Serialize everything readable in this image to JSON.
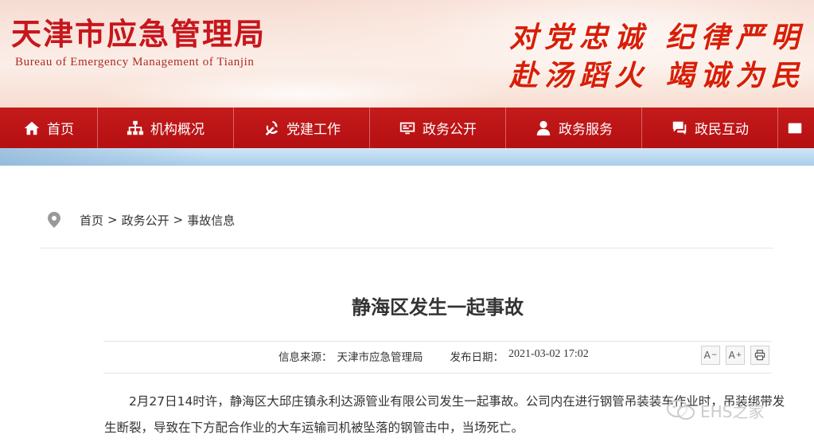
{
  "header": {
    "title": "天津市应急管理局",
    "subtitle": "Bureau of Emergency Management of Tianjin",
    "slogan_line1": "对党忠诚 纪律严明",
    "slogan_line2": "赴汤蹈火 竭诚为民"
  },
  "nav": {
    "items": [
      {
        "label": "首页",
        "icon": "home-icon"
      },
      {
        "label": "机构概况",
        "icon": "org-chart-icon"
      },
      {
        "label": "党建工作",
        "icon": "party-emblem-icon"
      },
      {
        "label": "政务公开",
        "icon": "monitor-icon"
      },
      {
        "label": "政务服务",
        "icon": "person-icon"
      },
      {
        "label": "政民互动",
        "icon": "chat-icon"
      },
      {
        "label": "",
        "icon": "more-icon"
      }
    ]
  },
  "breadcrumb": {
    "icon": "location-pin-icon",
    "items": [
      "首页",
      "政务公开",
      "事故信息"
    ],
    "separator": ">"
  },
  "article": {
    "title": "静海区发生一起事故",
    "source_label": "信息来源：",
    "source_value": "天津市应急管理局",
    "date_label": "发布日期：",
    "date_value": "2021-03-02 17:02",
    "body": "2月27日14时许，静海区大邱庄镇永利达源管业有限公司发生一起事故。公司内在进行钢管吊装装车作业时，吊装绑带发生断裂，导致在下方配合作业的大车运输司机被坠落的钢管击中，当场死亡。"
  },
  "tools": {
    "font_decrease": "A",
    "font_decrease_sup": "−",
    "font_increase": "A",
    "font_increase_sup": "+",
    "print_icon": "print-icon"
  },
  "watermark": {
    "text": "EHS之家",
    "icon": "wechat-icon"
  },
  "colors": {
    "brand_red": "#c8161d",
    "nav_red": "#b50f12",
    "band_blue": "#a9cde9"
  }
}
